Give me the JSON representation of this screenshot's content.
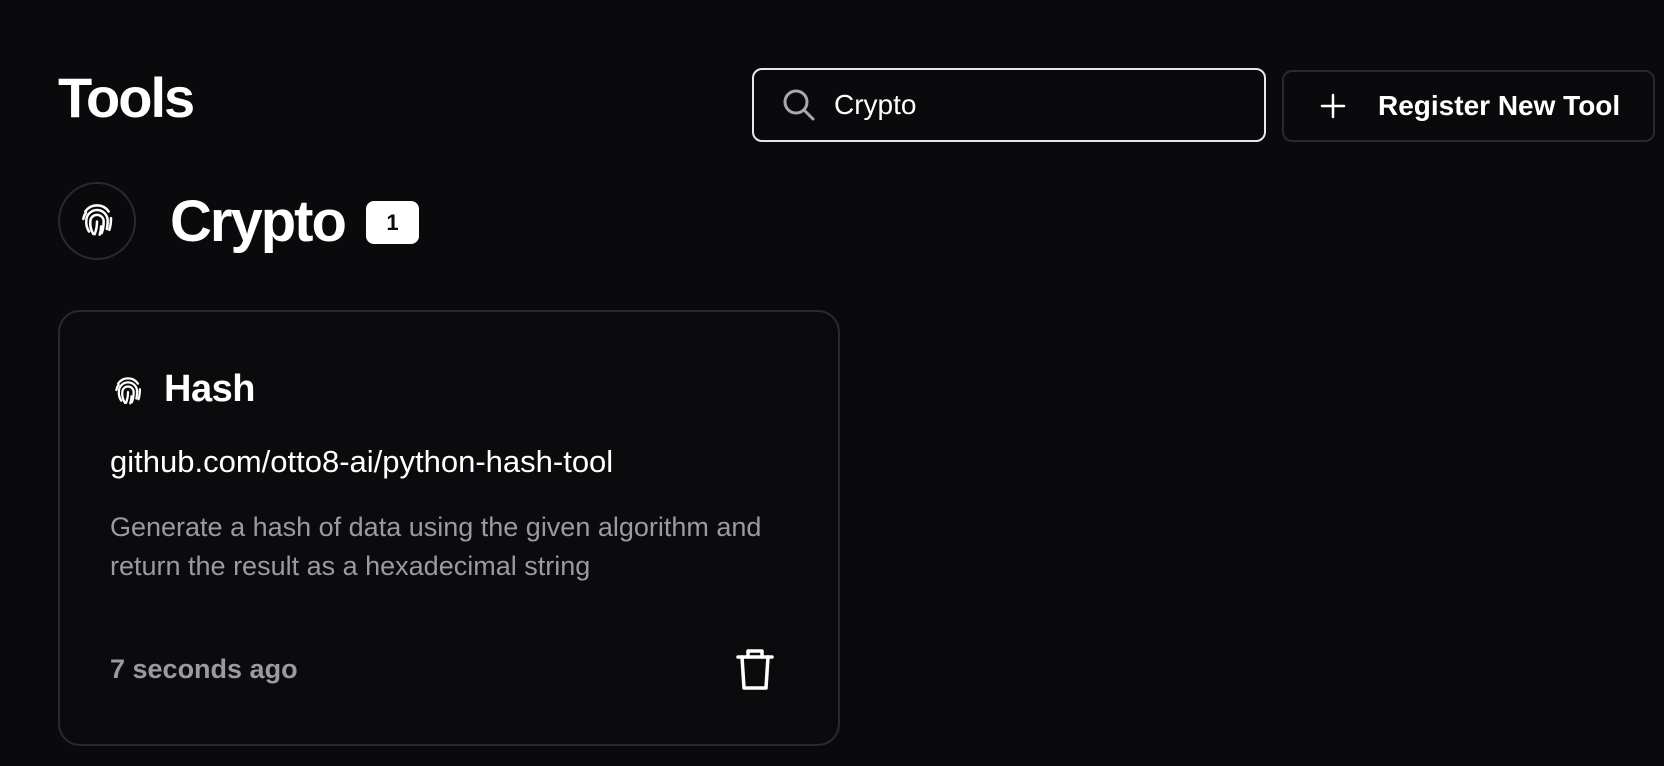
{
  "header": {
    "title": "Tools"
  },
  "search": {
    "value": "Crypto",
    "icon": "search-icon"
  },
  "actions": {
    "register_label": "Register New Tool",
    "register_icon": "plus-icon"
  },
  "category": {
    "name": "Crypto",
    "count": "1",
    "icon": "fingerprint-icon"
  },
  "tools": [
    {
      "name": "Hash",
      "icon": "fingerprint-icon",
      "repo": "github.com/otto8-ai/python-hash-tool",
      "description": "Generate a hash of data using the given algorithm and return the result as a hexadecimal string",
      "time": "7 seconds ago",
      "delete_icon": "trash-icon"
    }
  ],
  "colors": {
    "background": "#0a0a0c",
    "border": "#2a2a2e",
    "muted_text": "#9a9aa0",
    "text": "#ffffff"
  }
}
